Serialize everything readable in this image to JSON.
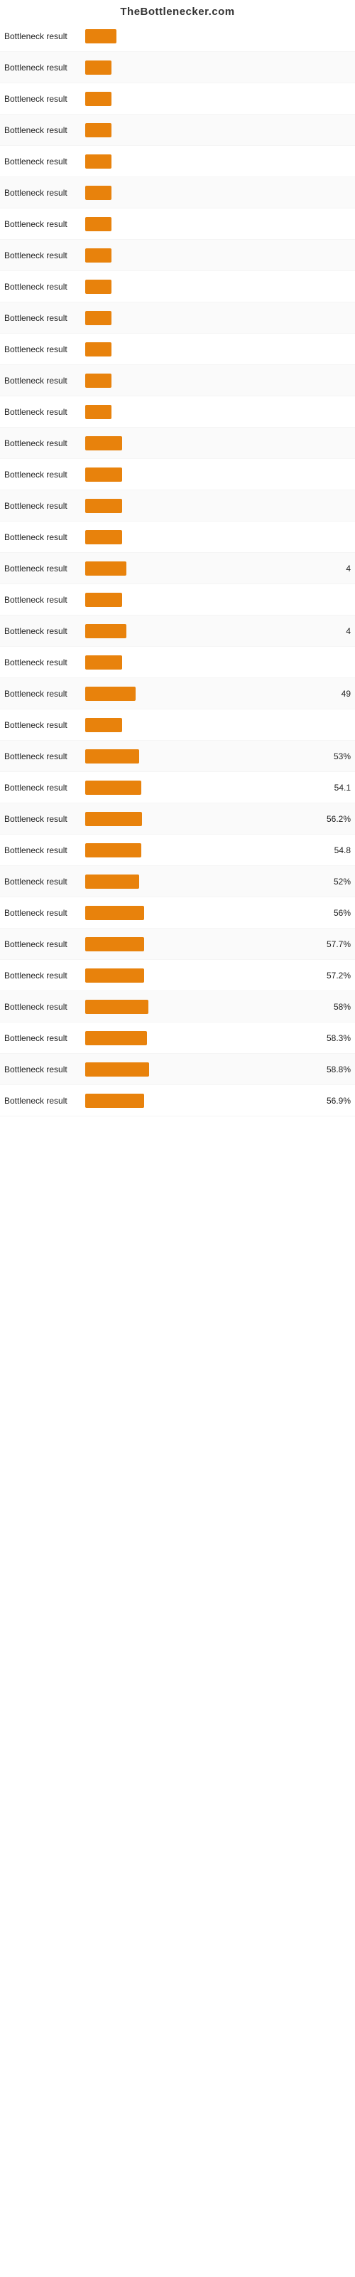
{
  "header": {
    "title": "TheBottlenecker.com"
  },
  "rows": [
    {
      "label": "Bottleneck result",
      "value": "",
      "width": 12
    },
    {
      "label": "Bottleneck result",
      "value": "",
      "width": 10
    },
    {
      "label": "Bottleneck result",
      "value": "",
      "width": 10
    },
    {
      "label": "Bottleneck result",
      "value": "",
      "width": 10
    },
    {
      "label": "Bottleneck result",
      "value": "",
      "width": 10
    },
    {
      "label": "Bottleneck result",
      "value": "",
      "width": 10
    },
    {
      "label": "Bottleneck result",
      "value": "",
      "width": 10
    },
    {
      "label": "Bottleneck result",
      "value": "",
      "width": 10
    },
    {
      "label": "Bottleneck result",
      "value": "",
      "width": 10
    },
    {
      "label": "Bottleneck result",
      "value": "",
      "width": 10
    },
    {
      "label": "Bottleneck result",
      "value": "",
      "width": 10
    },
    {
      "label": "Bottleneck result",
      "value": "",
      "width": 10
    },
    {
      "label": "Bottleneck result",
      "value": "",
      "width": 10
    },
    {
      "label": "Bottleneck result",
      "value": "",
      "width": 14
    },
    {
      "label": "Bottleneck result",
      "value": "",
      "width": 14
    },
    {
      "label": "Bottleneck result",
      "value": "",
      "width": 14
    },
    {
      "label": "Bottleneck result",
      "value": "",
      "width": 14
    },
    {
      "label": "Bottleneck result",
      "value": "4",
      "width": 16
    },
    {
      "label": "Bottleneck result",
      "value": "",
      "width": 14
    },
    {
      "label": "Bottleneck result",
      "value": "4",
      "width": 16
    },
    {
      "label": "Bottleneck result",
      "value": "",
      "width": 14
    },
    {
      "label": "Bottleneck result",
      "value": "49",
      "width": 20
    },
    {
      "label": "Bottleneck result",
      "value": "",
      "width": 14
    },
    {
      "label": "Bottleneck result",
      "value": "53%",
      "width": 22
    },
    {
      "label": "Bottleneck result",
      "value": "54.1",
      "width": 23
    },
    {
      "label": "Bottleneck result",
      "value": "56.2%",
      "width": 24
    },
    {
      "label": "Bottleneck result",
      "value": "54.8",
      "width": 23
    },
    {
      "label": "Bottleneck result",
      "value": "52%",
      "width": 22
    },
    {
      "label": "Bottleneck result",
      "value": "56%",
      "width": 24
    },
    {
      "label": "Bottleneck result",
      "value": "57.7%",
      "width": 25
    },
    {
      "label": "Bottleneck result",
      "value": "57.2%",
      "width": 25
    },
    {
      "label": "Bottleneck result",
      "value": "58%",
      "width": 26
    },
    {
      "label": "Bottleneck result",
      "value": "58.3%",
      "width": 26
    },
    {
      "label": "Bottleneck result",
      "value": "58.8%",
      "width": 27
    },
    {
      "label": "Bottleneck result",
      "value": "56.9%",
      "width": 25
    }
  ]
}
